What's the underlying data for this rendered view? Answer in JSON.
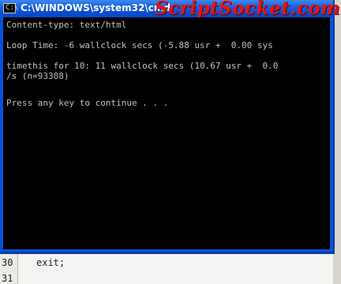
{
  "window": {
    "title": "C:\\WINDOWS\\system32\\cmd.exe",
    "title_visible": "C:\\WINDOWS\\system32\\cmd",
    "icon": "console-icon",
    "icon_glyph": "C:\\"
  },
  "watermark": "ScriptSocket.com",
  "console": {
    "lines": [
      "Content-type: text/html",
      "",
      "Loop Time: -6 wallclock secs (-5.88 usr +  0.00 sys",
      "",
      "timethis for 10: 11 wallclock secs (10.67 usr +  0.0",
      "/s (n=93308)",
      "",
      "Press any key to continue . . ."
    ]
  },
  "editor": {
    "line_numbers": [
      "30",
      "31"
    ],
    "code_lines": [
      "exit;",
      ""
    ]
  },
  "colors": {
    "title_bar": "#0a4fd4",
    "console_background": "#000000",
    "console_text": "#c0c0c0",
    "watermark": "#e01818"
  }
}
